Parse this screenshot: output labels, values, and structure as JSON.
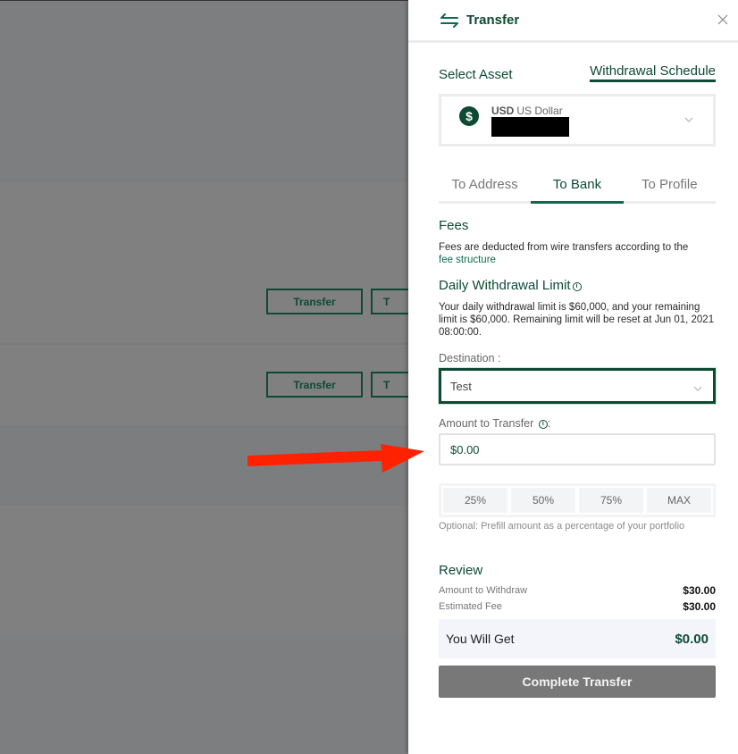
{
  "background": {
    "row_buttons": [
      {
        "label": "Transfer"
      },
      {
        "label": "Transfer"
      }
    ],
    "clipped_button_label": "T"
  },
  "drawer": {
    "title": "Transfer",
    "header_icon": "swap-arrows-icon",
    "close_icon": "close-icon",
    "close_label": "X",
    "select_asset_label": "Select Asset",
    "withdrawal_schedule_link": "Withdrawal Schedule",
    "asset": {
      "icon": "dollar-circle-icon",
      "icon_glyph": "$",
      "code": "USD",
      "name": "US Dollar",
      "balance_redacted": true
    },
    "tabs": [
      {
        "label": "To Address",
        "active": false
      },
      {
        "label": "To Bank",
        "active": true
      },
      {
        "label": "To Profile",
        "active": false
      }
    ],
    "fees": {
      "title": "Fees",
      "text": "Fees are deducted from wire transfers according to the",
      "link": "fee structure"
    },
    "daily_limit": {
      "title": "Daily Withdrawal Limit",
      "info_icon": "info-icon",
      "text": "Your daily withdrawal limit is $60,000, and your remaining limit is $60,000. Remaining limit will be reset at Jun 01, 2021 08:00:00."
    },
    "destination": {
      "label": "Destination :",
      "value": "Test"
    },
    "amount": {
      "label": "Amount to Transfer",
      "suffix": ":",
      "value": "$0.00"
    },
    "percent_buttons": [
      "25%",
      "50%",
      "75%",
      "MAX"
    ],
    "hint": "Optional: Prefill amount as a percentage of your portfolio",
    "review": {
      "title": "Review",
      "rows": [
        {
          "label": "Amount to Withdraw",
          "value": "$30.00"
        },
        {
          "label": "Estimated Fee",
          "value": "$30.00"
        }
      ],
      "you_will_get_label": "You Will Get",
      "you_will_get_value": "$0.00"
    },
    "submit_label": "Complete Transfer"
  },
  "colors": {
    "brand_green": "#0d4a33",
    "accent_green": "#0d6b4b",
    "overlay": "#7f8080",
    "annotation_arrow": "#ff2200",
    "disabled_button": "#787878"
  }
}
